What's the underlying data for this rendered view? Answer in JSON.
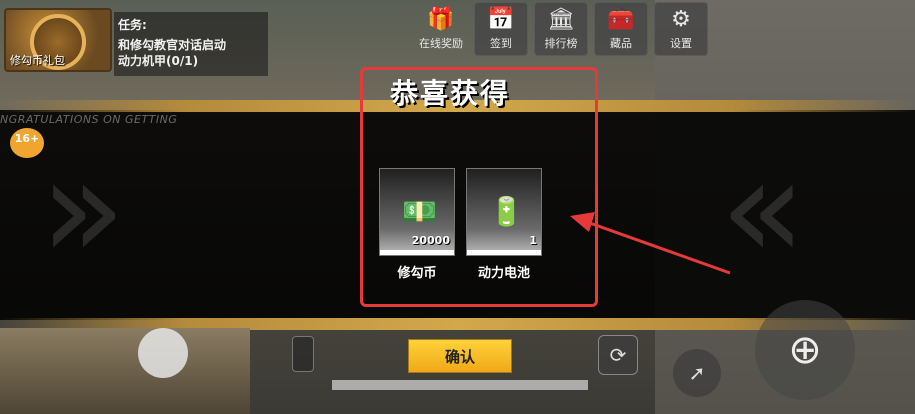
{
  "gift": {
    "label": "修勾币礼包"
  },
  "task": {
    "title": "任务:",
    "desc_line1": "和修勾教官对话启动",
    "desc_line2": "动力机甲(0/1)"
  },
  "top_menu": [
    {
      "label": "在线奖励",
      "icon": "gift-box-icon"
    },
    {
      "label": "签到",
      "icon": "calendar-check-icon"
    },
    {
      "label": "排行榜",
      "icon": "leaderboard-icon"
    },
    {
      "label": "藏品",
      "icon": "treasure-chest-icon"
    },
    {
      "label": "设置",
      "icon": "gear-icon"
    }
  ],
  "congrats_en": "NGRATULATIONS ON GETTING",
  "age_badge": "16+",
  "modal": {
    "title": "恭喜获得",
    "items": [
      {
        "name": "修勾币",
        "quantity": "20000",
        "icon": "cash-stack-icon"
      },
      {
        "name": "动力电池",
        "quantity": "1",
        "icon": "battery-icon"
      }
    ],
    "confirm_label": "确认"
  },
  "colors": {
    "highlight_frame": "#e53a3a",
    "confirm_button": "#ffd23a",
    "gold_band": "#d3a84c"
  }
}
